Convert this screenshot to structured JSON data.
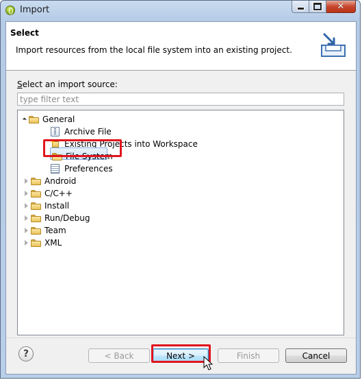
{
  "window": {
    "title": "Import"
  },
  "header": {
    "title": "Select",
    "description": "Import resources from the local file system into an existing project."
  },
  "source": {
    "label_prefix": "S",
    "label_rest": "elect an import source:",
    "filter_placeholder": "type filter text",
    "filter_value": ""
  },
  "tree": {
    "general": {
      "label": "General",
      "expanded": true,
      "children": [
        {
          "label": "Archive File",
          "icon": "archive-file-icon"
        },
        {
          "label": "Existing Projects into Workspace",
          "icon": "projects-icon"
        },
        {
          "label": "File System",
          "icon": "folder-icon",
          "selected": true
        },
        {
          "label": "Preferences",
          "icon": "preferences-icon"
        }
      ]
    },
    "categories": [
      "Android",
      "C/C++",
      "Install",
      "Run/Debug",
      "Team",
      "XML"
    ]
  },
  "buttons": {
    "help": "?",
    "back": "< Back",
    "next": "Next >",
    "finish": "Finish",
    "cancel": "Cancel"
  },
  "colors": {
    "highlight_box": "#e0151d",
    "selection": "#d3e6fa",
    "frame": "#b9cee8"
  }
}
